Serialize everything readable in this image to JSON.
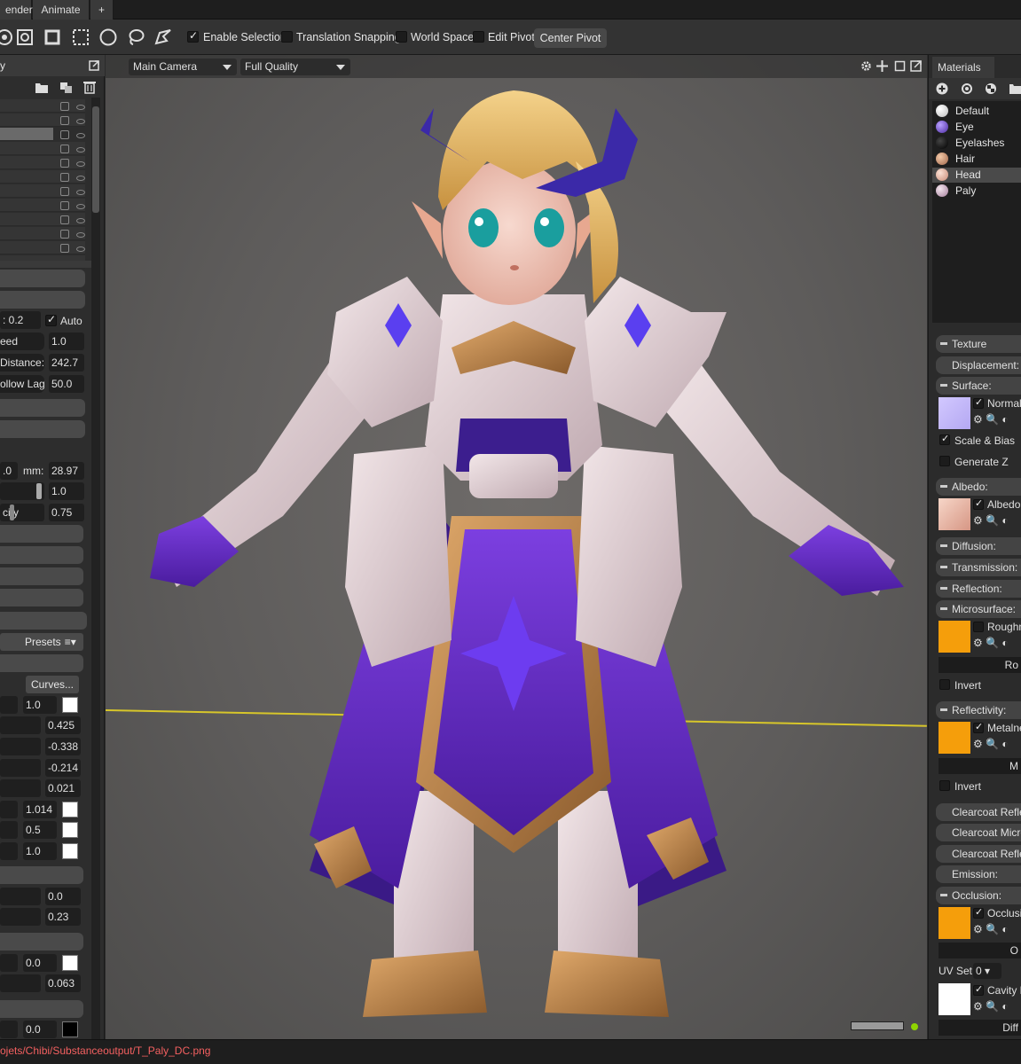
{
  "tabs": {
    "render": "ender",
    "animate": "Animate",
    "add": "+"
  },
  "toolbar": {
    "icons": [
      "rotate-icon",
      "scale-icon",
      "frame-icon",
      "box-select-icon",
      "ellipse-select-icon",
      "lasso-icon",
      "paint-select-icon"
    ],
    "enable_selection": {
      "label": "Enable Selection",
      "checked": true
    },
    "translation_snapping": {
      "label": "Translation Snapping",
      "checked": false
    },
    "world_space": {
      "label": "World Space",
      "checked": false
    },
    "edit_pivot": {
      "label": "Edit Pivot",
      "checked": false
    },
    "center_pivot": "Center Pivot"
  },
  "left_panel": {
    "tab_fragment": "y",
    "fields": {
      "auto_label": "Auto",
      "auto_value": "0.2",
      "speed_label": "eed",
      "speed_value": "1.0",
      "distance_label": "Distance:",
      "distance_value": "242.7",
      "follow_lag_label": "ollow Lag",
      "follow_lag_value": "50.0",
      "mm_label": "mm:",
      "mm_left_value": ".0",
      "mm_value": "28.97",
      "slider_value": "1.0",
      "opacity_label": "city",
      "opacity_value": "0.75",
      "presets": "Presets",
      "curves": "Curves...",
      "v1": "1.0",
      "v2": "0.425",
      "v3": "-0.338",
      "v4": "-0.214",
      "v5": "0.021",
      "v6": "1.014",
      "v7": "0.5",
      "v8": "1.0",
      "v9": "0.0",
      "v10": "0.23",
      "v11": "0.0",
      "v12": "0.063",
      "v13": "0.0"
    }
  },
  "viewport": {
    "camera": "Main Camera",
    "quality": "Full Quality"
  },
  "materials": {
    "tab": "Materials",
    "items": [
      {
        "name": "Default",
        "color": "#e8e8e8"
      },
      {
        "name": "Eye",
        "color": "#7d5fd9"
      },
      {
        "name": "Eyelashes",
        "color": "#151515"
      },
      {
        "name": "Hair",
        "color": "#d9a07a"
      },
      {
        "name": "Head",
        "color": "#e6b5a4"
      },
      {
        "name": "Paly",
        "color": "#d8c3cf"
      }
    ],
    "selected": "Head",
    "sections": {
      "texture": "Texture",
      "displacement": "Displacement:",
      "surface": "Surface:",
      "normal": "Normal",
      "scale_bias": "Scale & Bias",
      "generate_z": "Generate Z",
      "albedo": "Albedo:",
      "albedo_map": "Albedo",
      "diffusion": "Diffusion:",
      "transmission": "Transmission:",
      "reflection": "Reflection:",
      "microsurface": "Microsurface:",
      "roughness": "Roughn",
      "ro_btn": "Ro",
      "invert1": "Invert",
      "reflectivity": "Reflectivity:",
      "metalness": "Metalne",
      "m_btn": "M",
      "invert2": "Invert",
      "clearcoat_reflection": "Clearcoat Refle",
      "clearcoat_micro": "Clearcoat Micro",
      "clearcoat_reflect2": "Clearcoat Refle",
      "emission": "Emission:",
      "occlusion": "Occlusion:",
      "occlusion_map": "Occlusi",
      "o_btn": "O",
      "uv_set": "UV Set",
      "uv_value": "0",
      "cavity": "Cavity M",
      "diff_btn": "Diff"
    }
  },
  "status": {
    "path": "ojets/Chibi/Substanceoutput/T_Paly_DC.png"
  }
}
